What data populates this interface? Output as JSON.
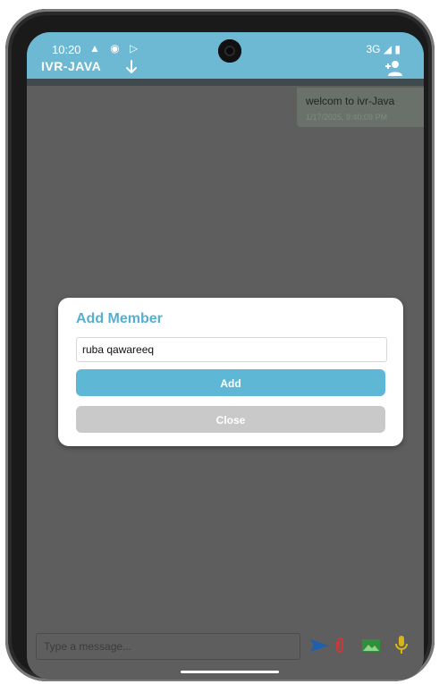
{
  "status_bar": {
    "time": "10:20",
    "left_icons": "▲ ◉ ▷",
    "network": "3G ◢ ▮"
  },
  "header": {
    "title": "IVR-JAVA",
    "accent_color": "#6db9d4"
  },
  "message": {
    "text": "welcom to ivr-Java",
    "timestamp": "1/17/2025, 9:40:09 PM"
  },
  "dialog": {
    "title": "Add Member",
    "input_value": "ruba qawareeq",
    "add_label": "Add",
    "close_label": "Close"
  },
  "composer": {
    "placeholder": "Type a message..."
  },
  "icons": [
    "down-arrow-icon",
    "add-person-icon",
    "send-icon",
    "attach-icon",
    "image-icon",
    "mic-icon"
  ]
}
